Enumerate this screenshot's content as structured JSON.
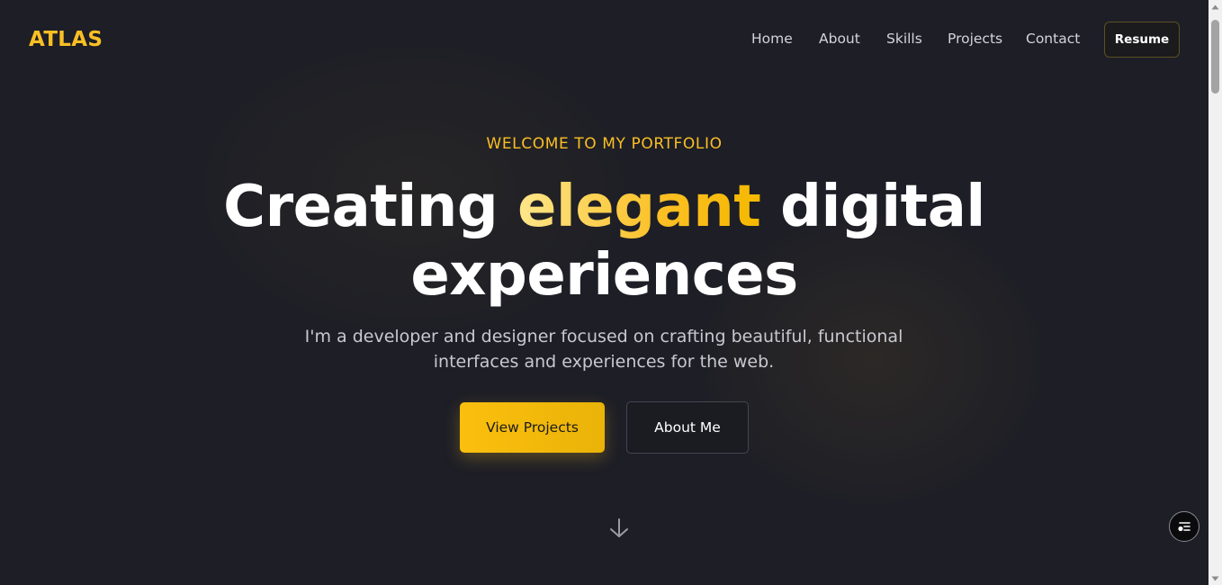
{
  "header": {
    "logo": "ATLAS",
    "nav": [
      "Home",
      "About",
      "Skills",
      "Projects",
      "Contact"
    ],
    "resume_label": "Resume"
  },
  "hero": {
    "eyebrow": "WELCOME TO MY PORTFOLIO",
    "headline_part1": "Creating ",
    "headline_accent": "elegant",
    "headline_part2": " digital",
    "headline_line2": "experiences",
    "subtitle": "I'm a developer and designer focused on crafting beautiful, functional interfaces and experiences for the web.",
    "primary_button": "View Projects",
    "secondary_button": "About Me"
  },
  "icons": {
    "scroll_indicator": "arrow-down-icon",
    "floating_button": "accessibility-menu-icon"
  },
  "colors": {
    "background": "#1d1e26",
    "accent": "#fbbf24",
    "text": "#ffffff",
    "muted_text": "#c8c8d0"
  }
}
